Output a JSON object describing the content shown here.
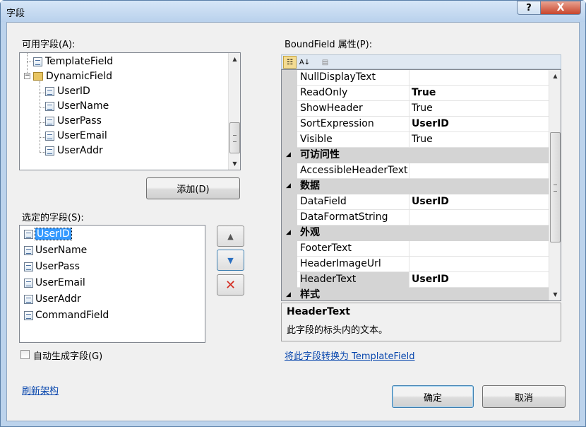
{
  "window": {
    "title": "字段",
    "help_label": "?",
    "close_label": "X"
  },
  "available": {
    "label": "可用字段(A):",
    "items": [
      "TemplateField",
      "DynamicField",
      "UserID",
      "UserName",
      "UserPass",
      "UserEmail",
      "UserAddr"
    ]
  },
  "add_button": "添加(D)",
  "selected": {
    "label": "选定的字段(S):",
    "items": [
      "UserID",
      "UserName",
      "UserPass",
      "UserEmail",
      "UserAddr",
      "CommandField"
    ],
    "selected_index": 0
  },
  "move_up_icon": "arrow-up-icon",
  "move_down_icon": "arrow-down-icon",
  "delete_icon": "red-x-icon",
  "properties": {
    "label": "BoundField 属性(P):",
    "toolbar": {
      "categorized_icon": "categorized-icon",
      "alphabetical_icon": "alphabetical-icon",
      "pages_icon": "property-pages-icon"
    },
    "rows": [
      {
        "type": "prop",
        "name": "NullDisplayText",
        "value": "",
        "bold": false
      },
      {
        "type": "prop",
        "name": "ReadOnly",
        "value": "True",
        "bold": true
      },
      {
        "type": "prop",
        "name": "ShowHeader",
        "value": "True",
        "bold": false
      },
      {
        "type": "prop",
        "name": "SortExpression",
        "value": "UserID",
        "bold": true
      },
      {
        "type": "prop",
        "name": "Visible",
        "value": "True",
        "bold": false
      },
      {
        "type": "cat",
        "name": "可访问性"
      },
      {
        "type": "prop",
        "name": "AccessibleHeaderText",
        "value": "",
        "bold": false
      },
      {
        "type": "cat",
        "name": "数据"
      },
      {
        "type": "prop",
        "name": "DataField",
        "value": "UserID",
        "bold": true
      },
      {
        "type": "prop",
        "name": "DataFormatString",
        "value": "",
        "bold": false
      },
      {
        "type": "cat",
        "name": "外观"
      },
      {
        "type": "prop",
        "name": "FooterText",
        "value": "",
        "bold": false
      },
      {
        "type": "prop",
        "name": "HeaderImageUrl",
        "value": "",
        "bold": false
      },
      {
        "type": "prop",
        "name": "HeaderText",
        "value": "UserID",
        "bold": true,
        "selected": true
      },
      {
        "type": "cat",
        "name": "样式"
      }
    ],
    "description": {
      "title": "HeaderText",
      "text": "此字段的标头内的文本。"
    }
  },
  "convert_link": "将此字段转换为 TemplateField",
  "auto_generate": {
    "label": "自动生成字段(G)",
    "checked": false
  },
  "refresh_link": "刷新架构",
  "ok_button": "确定",
  "cancel_button": "取消"
}
